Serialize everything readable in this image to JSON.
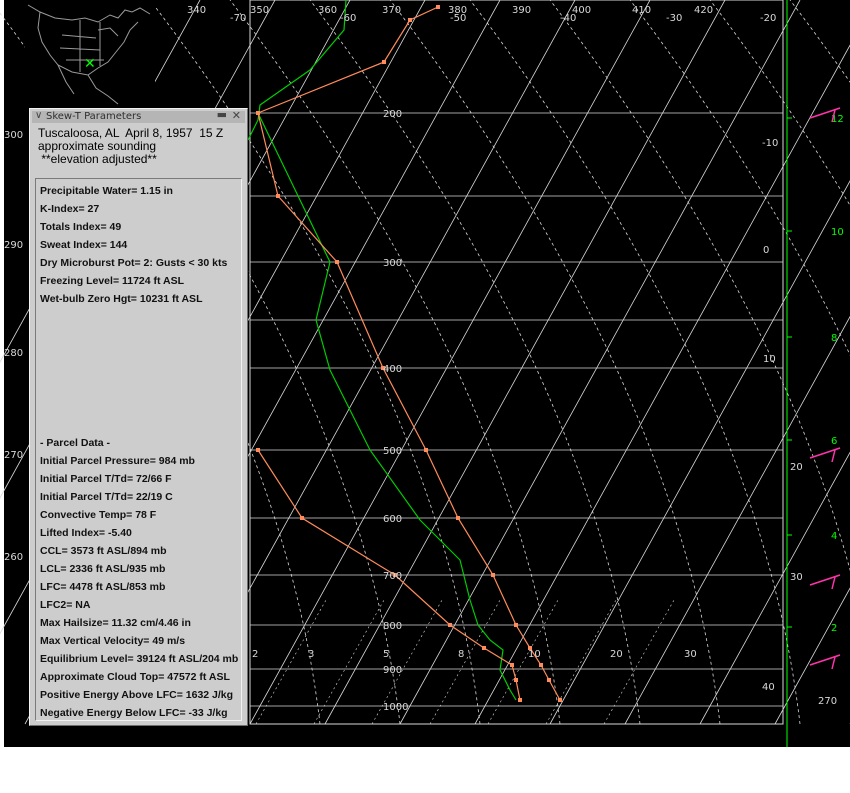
{
  "window": {
    "title": "Skew-T Parameters"
  },
  "header": {
    "lines": [
      "Tuscaloosa, AL  April 8, 1957  15 Z",
      "approximate sounding",
      " **elevation adjusted**"
    ]
  },
  "params": [
    "Precipitable Water= 1.15 in",
    "K-Index= 27",
    "Totals Index= 49",
    "Sweat Index= 144",
    "Dry Microburst Pot= 2: Gusts < 30 kts",
    "Freezing Level= 11724 ft ASL",
    "Wet-bulb Zero Hgt= 10231 ft ASL"
  ],
  "parcel": [
    "- Parcel Data -",
    "Initial Parcel Pressure= 984 mb",
    "Initial Parcel T/Td= 72/66 F",
    "Initial Parcel T/Td= 22/19 C",
    "Convective Temp= 78 F",
    "Lifted Index= -5.40",
    "CCL= 3573 ft ASL/894 mb",
    "LCL= 2336 ft ASL/935 mb",
    "LFC= 4478 ft ASL/853 mb",
    "LFC2= NA",
    "Max Hailsize= 11.32 cm/4.46 in",
    "Max Vertical Velocity= 49 m/s",
    "Equilibrium Level= 39124 ft ASL/204 mb",
    "Approximate Cloud Top= 47572 ft ASL",
    "Positive Energy Above LFC= 1632 J/kg",
    "Negative Energy Below LFC= -33 J/kg"
  ],
  "skewt": {
    "pressure_labels": [
      "200",
      "300",
      "400",
      "500",
      "600",
      "700",
      "800",
      "900",
      "1000"
    ],
    "theta_labels": [
      "340",
      "350",
      "360",
      "370",
      "380",
      "390",
      "400",
      "410",
      "420"
    ],
    "temp_top_labels": [
      "-70",
      "-60",
      "-50",
      "-40",
      "-30",
      "-20"
    ],
    "temp_right_labels": [
      "-10",
      "0",
      "10",
      "20",
      "30",
      "40"
    ],
    "mixing_labels": [
      "2",
      "3",
      "5",
      "8",
      "10",
      "20",
      "30"
    ],
    "left_edge_labels": [
      "300",
      "290",
      "280",
      "270",
      "260"
    ],
    "height_labels": [
      "12",
      "10",
      "8",
      "6",
      "4",
      "2"
    ],
    "bottom_right_label": "270",
    "colors": {
      "background": "#000000",
      "temperature": "#ff8c5a",
      "dewpoint": "#00cc00",
      "lines": "#d8d8d8",
      "height": "#00ff00",
      "wind": "#ff33aa"
    }
  }
}
